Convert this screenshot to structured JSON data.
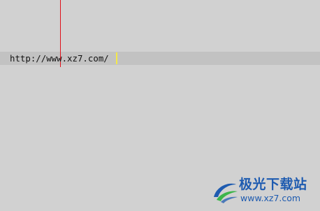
{
  "editor": {
    "line_text": "http://www.xz7.com/"
  },
  "watermark": {
    "title": "极光下载站",
    "url": "www.xz7.com",
    "logo_icon": "aurora-swirl-icon",
    "colors": {
      "blue": "#1e5bb0",
      "green": "#3cb54a"
    }
  },
  "colors": {
    "background": "#d1d1d1",
    "current_line": "#c2c2c2",
    "margin_line": "#e0101a",
    "caret": "#f4e84a"
  }
}
